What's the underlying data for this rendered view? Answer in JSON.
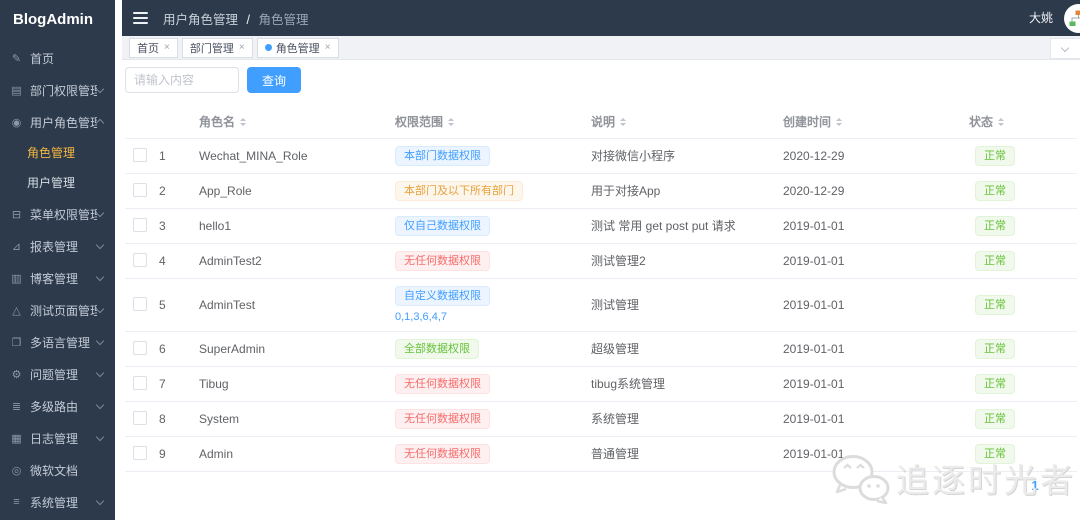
{
  "app": {
    "name": "BlogAdmin"
  },
  "colors": {
    "accent": "#409eff",
    "success": "#67c23a",
    "warning": "#e6a23c",
    "danger": "#f56c6c",
    "sidebar_bg": "#2d3a4b",
    "active_menu": "#f4b73f"
  },
  "navbar": {
    "breadcrumb": {
      "parent": "用户角色管理",
      "separator": "/",
      "current": "角色管理"
    },
    "username": "大姚"
  },
  "sidebar": {
    "items": [
      {
        "id": "home",
        "icon_name": "home-icon",
        "icon": "✎",
        "label": "首页",
        "chevron": false
      },
      {
        "id": "dept-permission",
        "icon_name": "department-icon",
        "icon": "▤",
        "label": "部门权限管理",
        "chevron": true
      },
      {
        "id": "user-role",
        "icon_name": "users-icon",
        "icon": "◉",
        "label": "用户角色管理",
        "chevron": true,
        "expanded": true,
        "children": [
          {
            "id": "role-manage",
            "label": "角色管理",
            "active": true
          },
          {
            "id": "user-manage",
            "label": "用户管理",
            "active": false
          }
        ]
      },
      {
        "id": "menu-permission",
        "icon_name": "menu-tree-icon",
        "icon": "⊟",
        "label": "菜单权限管理",
        "chevron": true
      },
      {
        "id": "report",
        "icon_name": "chart-icon",
        "icon": "⊿",
        "label": "报表管理",
        "chevron": true
      },
      {
        "id": "blog",
        "icon_name": "blog-icon",
        "icon": "▥",
        "label": "博客管理",
        "chevron": true
      },
      {
        "id": "test-page",
        "icon_name": "test-flask-icon",
        "icon": "△",
        "label": "测试页面管理",
        "chevron": true
      },
      {
        "id": "multi-language",
        "icon_name": "language-icon",
        "icon": "❐",
        "label": "多语言管理",
        "chevron": true
      },
      {
        "id": "question",
        "icon_name": "question-icon",
        "icon": "⚙",
        "label": "问题管理",
        "chevron": true
      },
      {
        "id": "multi-level-route",
        "icon_name": "route-icon",
        "icon": "≣",
        "label": "多级路由",
        "chevron": true
      },
      {
        "id": "log",
        "icon_name": "log-icon",
        "icon": "▦",
        "label": "日志管理",
        "chevron": true
      },
      {
        "id": "ms-docs",
        "icon_name": "docs-icon",
        "icon": "◎",
        "label": "微软文档",
        "chevron": false
      },
      {
        "id": "system",
        "icon_name": "system-icon",
        "icon": "≡",
        "label": "系统管理",
        "chevron": true
      }
    ]
  },
  "tabs": [
    {
      "id": "home",
      "label": "首页",
      "active": false
    },
    {
      "id": "dept-manage",
      "label": "部门管理",
      "active": false
    },
    {
      "id": "role-manage",
      "label": "角色管理",
      "active": true
    }
  ],
  "icons": {
    "close": "×"
  },
  "search": {
    "placeholder": "请输入内容",
    "button": "查询"
  },
  "table": {
    "headers": [
      "角色名",
      "权限范围",
      "说明",
      "创建时间",
      "状态"
    ],
    "rows": [
      {
        "index": "1",
        "name": "Wechat_MINA_Role",
        "scope": "本部门数据权限",
        "scope_type": "info",
        "desc": "对接微信小程序",
        "created": "2020-12-29",
        "status": "正常"
      },
      {
        "index": "2",
        "name": "App_Role",
        "scope": "本部门及以下所有部门",
        "scope_type": "warning",
        "desc": "用于对接App",
        "created": "2020-12-29",
        "status": "正常"
      },
      {
        "index": "3",
        "name": "hello1",
        "scope": "仅自己数据权限",
        "scope_type": "info",
        "desc": "测试 常用 get post put 请求",
        "created": "2019-01-01",
        "status": "正常"
      },
      {
        "index": "4",
        "name": "AdminTest2",
        "scope": "无任何数据权限",
        "scope_type": "danger",
        "desc": "测试管理2",
        "created": "2019-01-01",
        "status": "正常"
      },
      {
        "index": "5",
        "name": "AdminTest",
        "scope": "自定义数据权限",
        "scope_type": "info",
        "scope_extra": "0,1,3,6,4,7",
        "desc": "测试管理",
        "created": "2019-01-01",
        "status": "正常"
      },
      {
        "index": "6",
        "name": "SuperAdmin",
        "scope": "全部数据权限",
        "scope_type": "success",
        "desc": "超级管理",
        "created": "2019-01-01",
        "status": "正常"
      },
      {
        "index": "7",
        "name": "Tibug",
        "scope": "无任何数据权限",
        "scope_type": "danger",
        "desc": "tibug系统管理",
        "created": "2019-01-01",
        "status": "正常"
      },
      {
        "index": "8",
        "name": "System",
        "scope": "无任何数据权限",
        "scope_type": "danger",
        "desc": "系统管理",
        "created": "2019-01-01",
        "status": "正常"
      },
      {
        "index": "9",
        "name": "Admin",
        "scope": "无任何数据权限",
        "scope_type": "danger",
        "desc": "普通管理",
        "created": "2019-01-01",
        "status": "正常"
      }
    ]
  },
  "pagination": {
    "prev": "‹",
    "current": "1",
    "next": "›"
  },
  "watermark": {
    "text": "追逐时光者"
  }
}
